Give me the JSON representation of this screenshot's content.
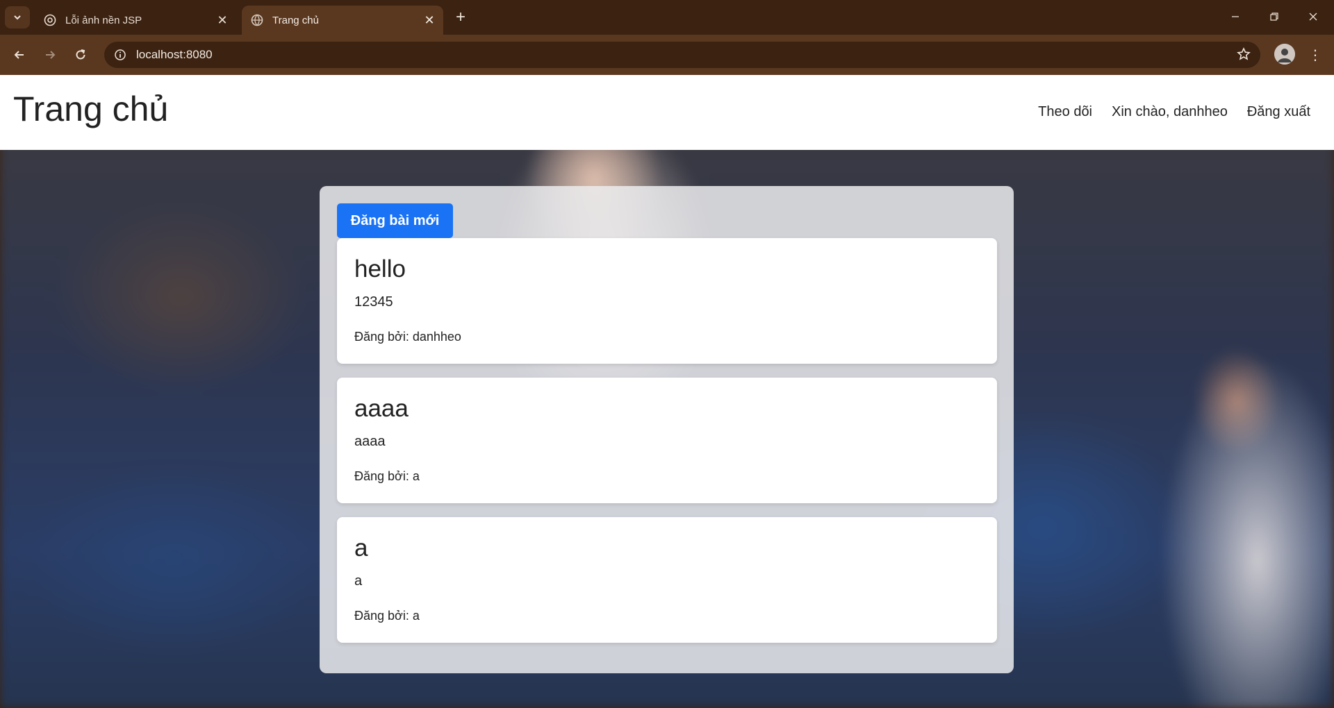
{
  "browser": {
    "tabs": [
      {
        "title": "Lỗi ảnh nền JSP",
        "active": false
      },
      {
        "title": "Trang chủ",
        "active": true
      }
    ],
    "url": "localhost:8080"
  },
  "navbar": {
    "brand": "Trang chủ",
    "links": [
      "Theo dõi",
      "Xin chào, danhheo",
      "Đăng xuất"
    ]
  },
  "main": {
    "new_post_label": "Đăng bài mới",
    "posts": [
      {
        "title": "hello",
        "content": "12345",
        "author": "Đăng bởi: danhheo"
      },
      {
        "title": "aaaa",
        "content": "aaaa",
        "author": "Đăng bởi: a"
      },
      {
        "title": "a",
        "content": "a",
        "author": "Đăng bởi: a"
      }
    ]
  },
  "colors": {
    "primary": "#1a73f5",
    "chrome_dark": "#3b2211",
    "chrome_toolbar": "#5a3820"
  }
}
